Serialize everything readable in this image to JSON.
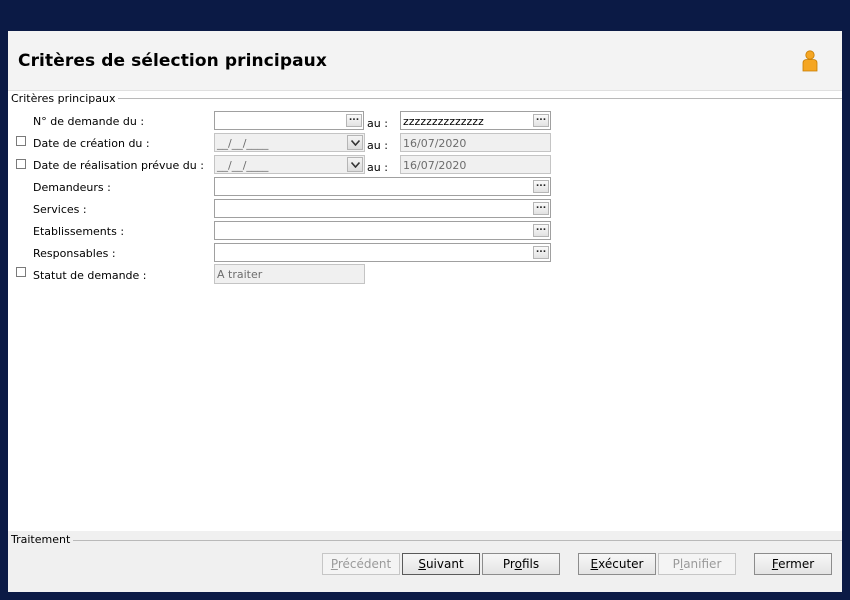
{
  "header": {
    "title": "Critères de sélection principaux",
    "user_icon": "user-icon"
  },
  "group_main": {
    "legend": "Critères principaux"
  },
  "form": {
    "demande_label": "N° de demande du :",
    "demande_from": "",
    "au_label": "au :",
    "demande_to": "zzzzzzzzzzzzzz",
    "creation_label": "Date de création du :",
    "creation_from": "__/__/____",
    "creation_to": "16/07/2020",
    "realisation_label": "Date de réalisation prévue du :",
    "realisation_from": "__/__/____",
    "realisation_to": "16/07/2020",
    "demandeurs_label": "Demandeurs :",
    "services_label": "Services :",
    "etablissements_label": "Etablissements :",
    "responsables_label": "Responsables :",
    "statut_label": "Statut de demande :",
    "statut_value": "A traiter"
  },
  "group_traitement": {
    "legend": "Traitement"
  },
  "buttons": {
    "precedent": {
      "pre": "",
      "key": "P",
      "post": "récédent"
    },
    "suivant": {
      "pre": "",
      "key": "S",
      "post": "uivant"
    },
    "profils": {
      "pre": "Pr",
      "key": "o",
      "post": "fils"
    },
    "executer": {
      "pre": "",
      "key": "E",
      "post": "xécuter"
    },
    "planifier": {
      "pre": "P",
      "key": "l",
      "post": "anifier"
    },
    "fermer": {
      "pre": "",
      "key": "F",
      "post": "ermer"
    }
  },
  "colors": {
    "background": "#0b1a45",
    "header": "#f3f3f3",
    "icon_orange": "#f5a623"
  }
}
